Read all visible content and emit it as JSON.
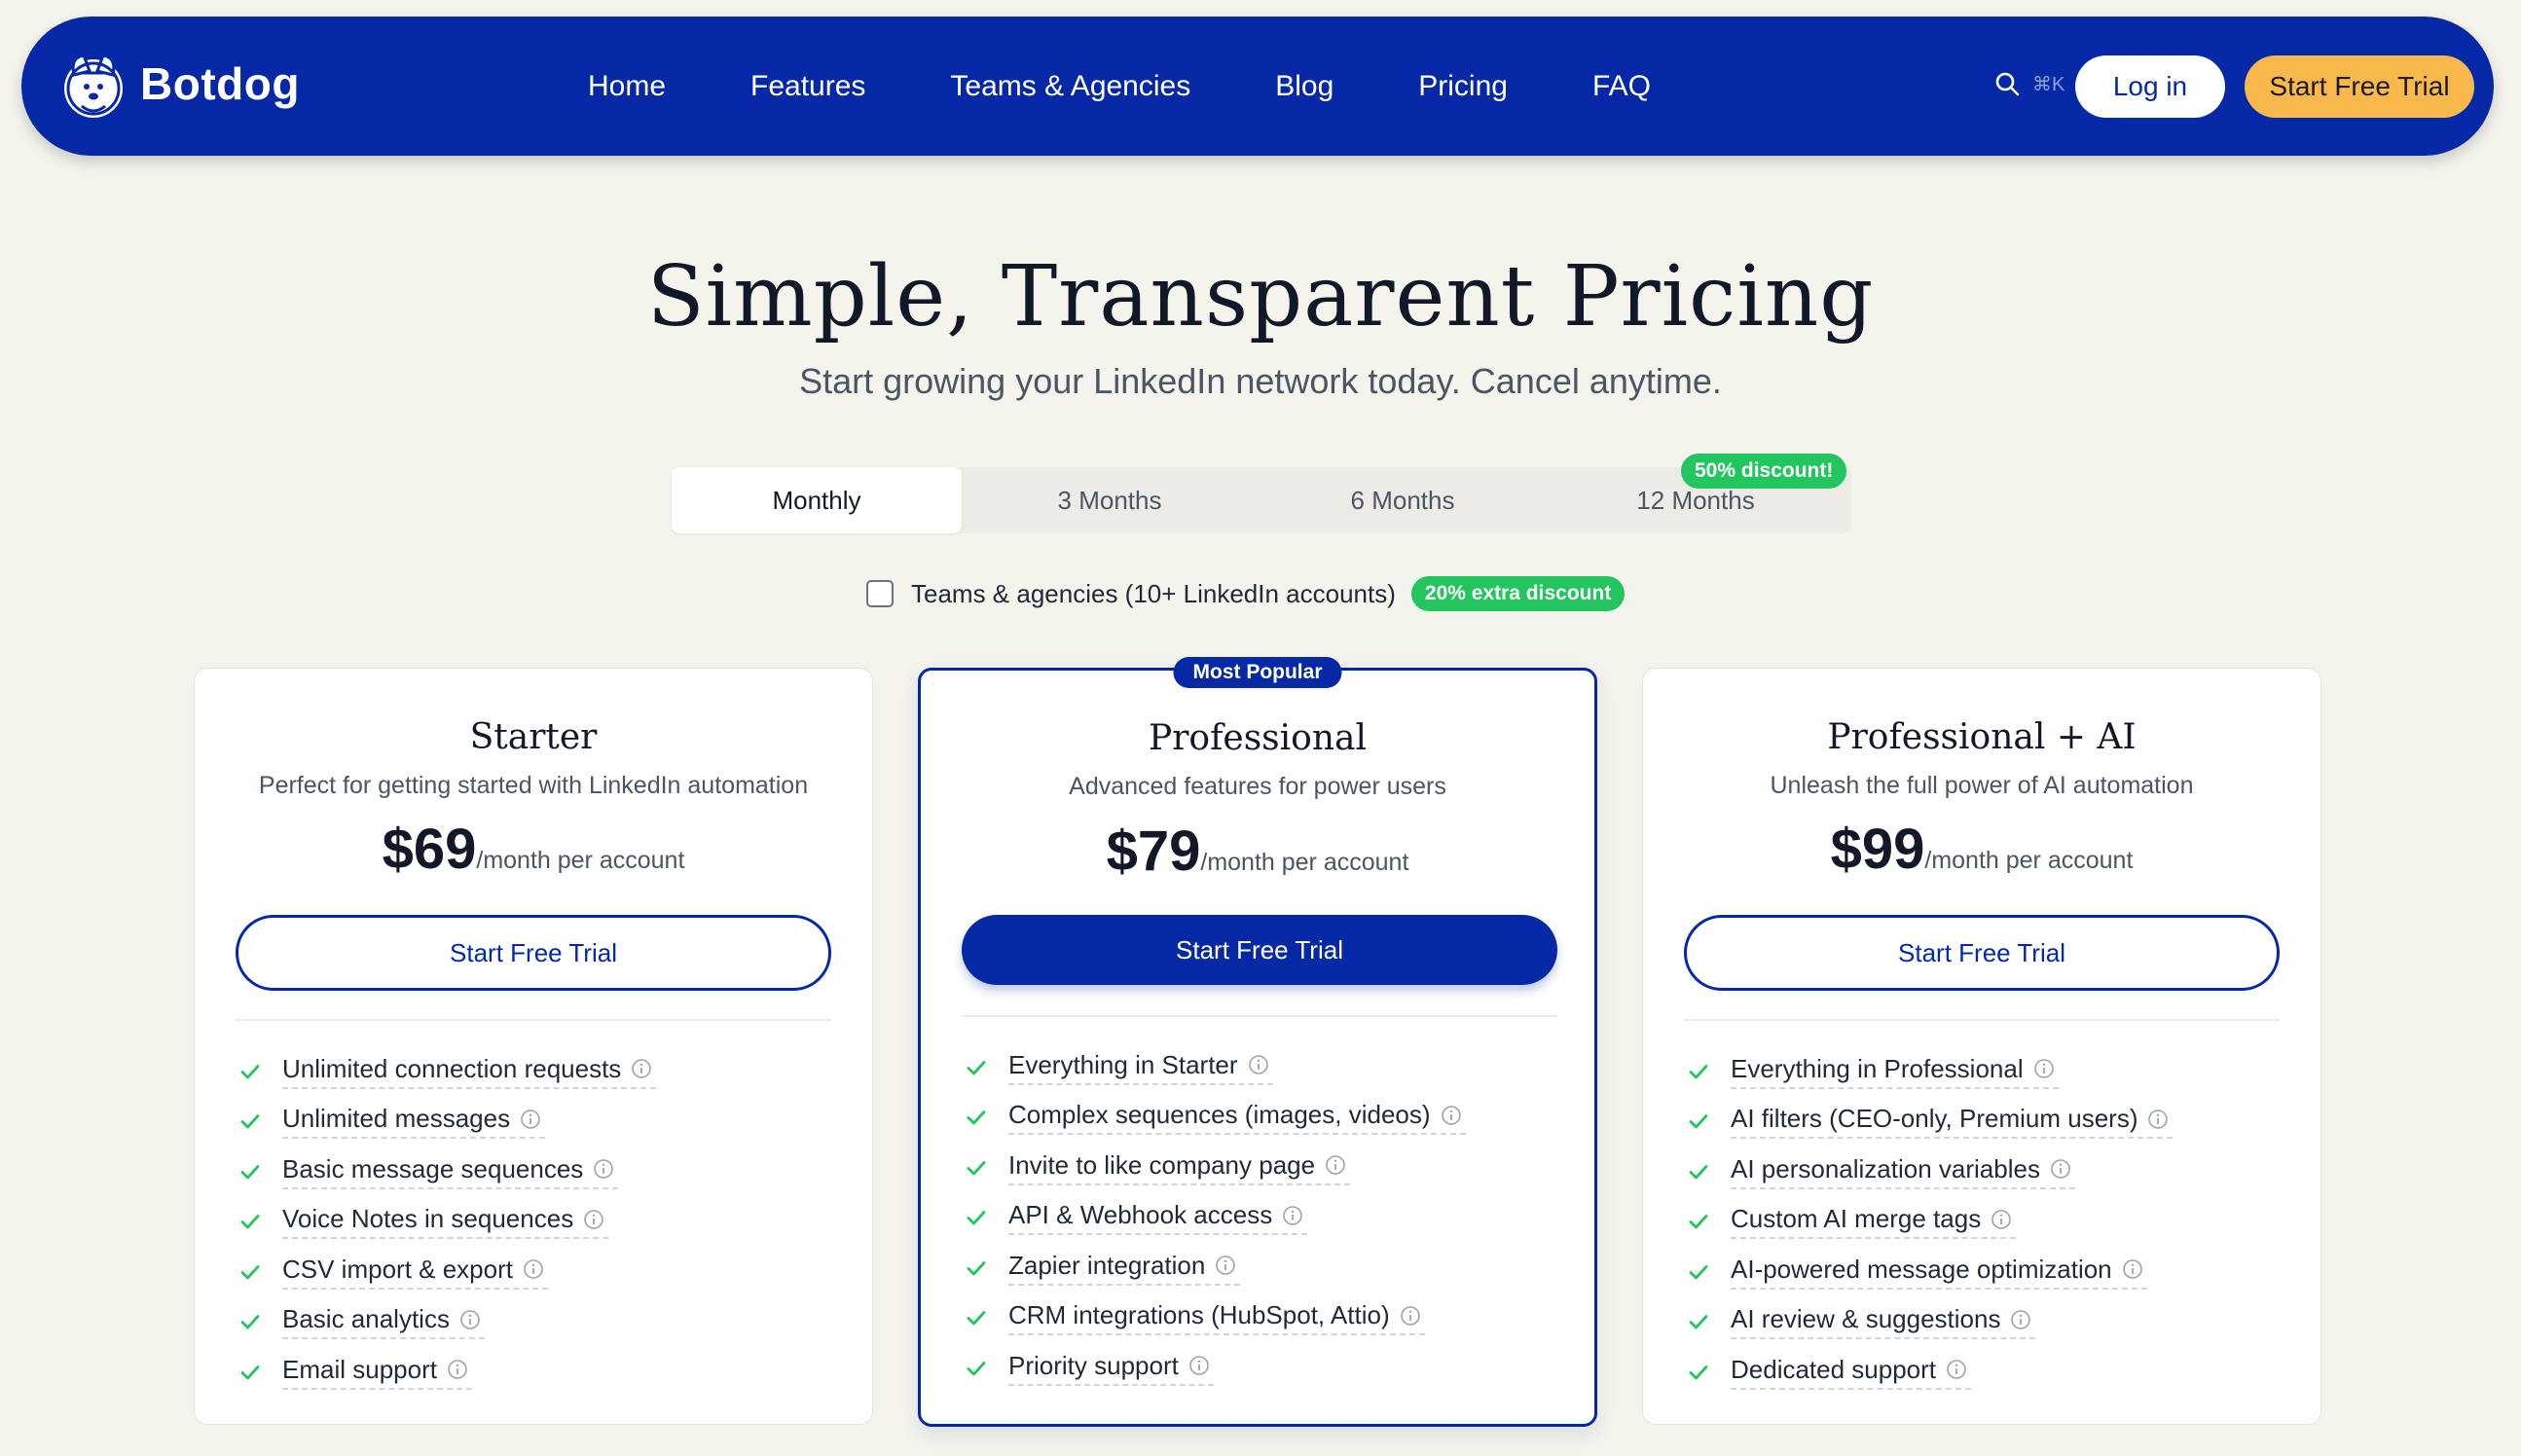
{
  "brand": {
    "name": "Botdog"
  },
  "nav": {
    "links": [
      "Home",
      "Features",
      "Teams & Agencies",
      "Blog",
      "Pricing",
      "FAQ"
    ],
    "search_shortcut": "⌘K",
    "login_label": "Log in",
    "trial_label": "Start Free Trial"
  },
  "hero": {
    "title": "Simple, Transparent Pricing",
    "subtitle": "Start growing your LinkedIn network today. Cancel anytime."
  },
  "periods": {
    "tabs": [
      "Monthly",
      "3 Months",
      "6 Months",
      "12 Months"
    ],
    "selected": "Monthly",
    "discount_badge": "50% discount!"
  },
  "teams": {
    "label": "Teams & agencies (10+ LinkedIn accounts)",
    "checked": false,
    "badge": "20% extra discount"
  },
  "colors": {
    "primary": "#0529a6",
    "accent": "#f9b84b",
    "success": "#22c55e",
    "background": "#f4f3ec"
  },
  "plans": [
    {
      "name": "Starter",
      "description": "Perfect for getting started with LinkedIn automation",
      "price": "$69",
      "price_unit": "/month per account",
      "cta": "Start Free Trial",
      "features": [
        "Unlimited connection requests",
        "Unlimited messages",
        "Basic message sequences",
        "Voice Notes in sequences",
        "CSV import & export",
        "Basic analytics",
        "Email support"
      ]
    },
    {
      "name": "Professional",
      "badge": "Most Popular",
      "description": "Advanced features for power users",
      "price": "$79",
      "price_unit": "/month per account",
      "cta": "Start Free Trial",
      "features": [
        "Everything in Starter",
        "Complex sequences (images, videos)",
        "Invite to like company page",
        "API & Webhook access",
        "Zapier integration",
        "CRM integrations (HubSpot, Attio)",
        "Priority support"
      ]
    },
    {
      "name": "Professional + AI",
      "description": "Unleash the full power of AI automation",
      "price": "$99",
      "price_unit": "/month per account",
      "cta": "Start Free Trial",
      "features": [
        "Everything in Professional",
        "AI filters (CEO-only, Premium users)",
        "AI personalization variables",
        "Custom AI merge tags",
        "AI-powered message optimization",
        "AI review & suggestions",
        "Dedicated support"
      ]
    }
  ]
}
